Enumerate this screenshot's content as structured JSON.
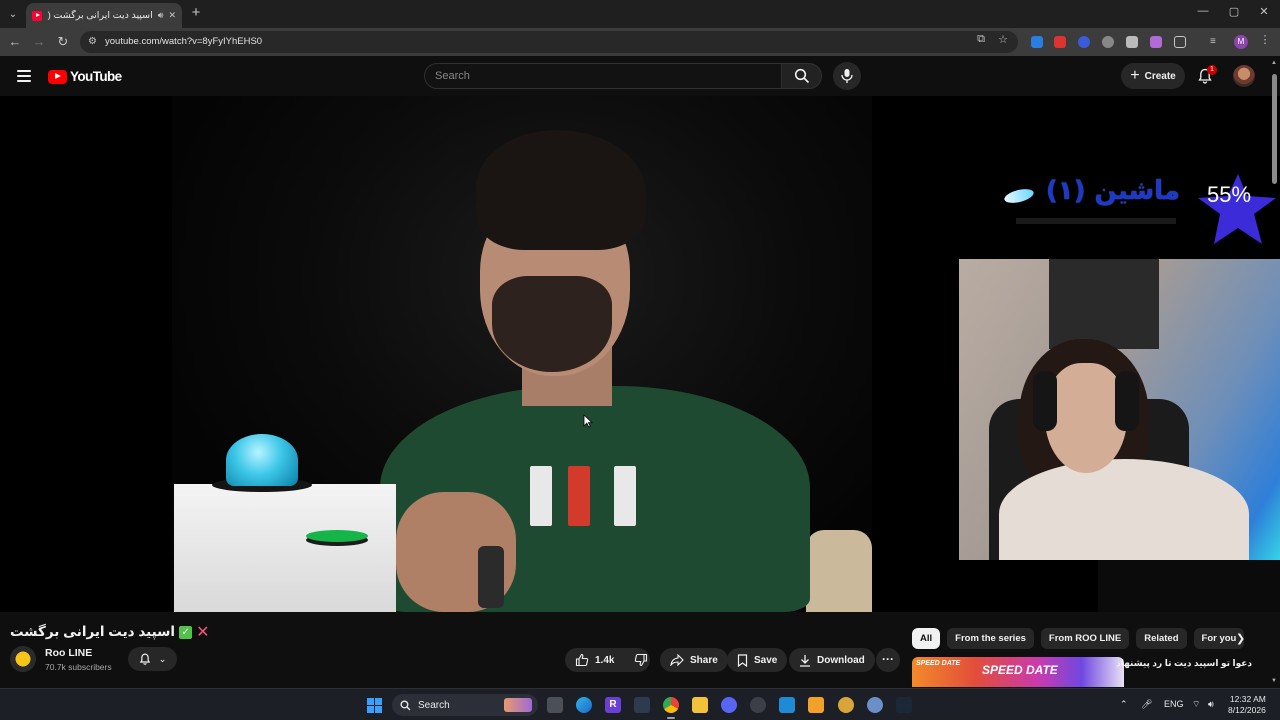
{
  "browser": {
    "tab_title": "اسپید دیت ایرانی برگشت (1)",
    "url": "youtube.com/watch?v=8yFyIYhEHS0"
  },
  "youtube": {
    "logo_text": "YouTube",
    "search_placeholder": "Search",
    "create_label": "Create",
    "notification_count": "1"
  },
  "video": {
    "overlay_title": "ماشین (۱)",
    "overlay_percent": "55%"
  },
  "watch": {
    "title": "اسپید دیت ایرانی برگشت",
    "channel_name": "Roo LINE",
    "subscribers": "70.7k subscribers",
    "like_count": "1.4k",
    "share_label": "Share",
    "save_label": "Save",
    "download_label": "Download"
  },
  "sidebar": {
    "chips": [
      {
        "label": "All",
        "active": true
      },
      {
        "label": "From the series",
        "active": false
      },
      {
        "label": "From ROO LINE",
        "active": false
      },
      {
        "label": "Related",
        "active": false
      },
      {
        "label": "For you",
        "active": false
      }
    ],
    "rec_title": "دعوا تو اسپید دیت تا رد پیشنهاد",
    "rec_thumb_tag": "SPEED DATE",
    "rec_thumb_tag2": "SPEED DATE"
  },
  "taskbar": {
    "search_label": "Search",
    "language": "ENG",
    "time": "12:32 AM",
    "date": "8/12/2026"
  },
  "colors": {
    "yt_red": "#ff0000",
    "background": "#0f0f0f",
    "chip_active_bg": "#f1f1f1",
    "button_bg": "#272727"
  },
  "icons": [
    "tab-list-icon",
    "youtube-favicon",
    "audio-icon",
    "close-icon",
    "new-tab-icon",
    "minimize-icon",
    "maximize-icon",
    "back-icon",
    "forward-icon",
    "reload-icon",
    "site-info-icon",
    "install-icon",
    "star-icon",
    "extension-icon",
    "menu-icon",
    "search-icon",
    "mic-icon",
    "bell-icon",
    "like-icon",
    "dislike-icon",
    "share-icon",
    "save-icon",
    "download-icon",
    "more-icon",
    "bell-subscribe-icon",
    "chevron-down-icon",
    "chevron-right-icon",
    "windows-icon"
  ]
}
